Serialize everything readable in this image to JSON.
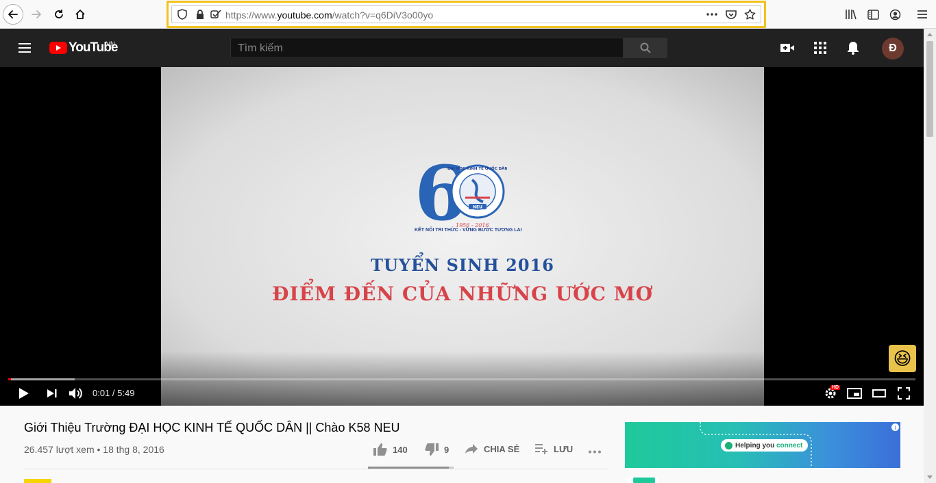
{
  "browser": {
    "url_prefix": "https://www.",
    "url_host": "youtube.com",
    "url_path": "/watch?v=q6DiV3o00yo",
    "accent_color": "#f3c21d"
  },
  "header": {
    "logo_text": "YouTube",
    "region": "VN",
    "search_placeholder": "Tìm kiếm",
    "avatar_initial": "Đ"
  },
  "player": {
    "logo_number": "6",
    "logo_ring_text": "ĐẠI HỌC KINH TẾ QUỐC DÂN",
    "logo_neu": "NEU",
    "logo_years": "1956 - 2016",
    "tagline": "KẾT NỐI TRI THỨC - VỮNG BƯỚC TƯƠNG LAI",
    "headline": "TUYỂN SINH 2016",
    "subheadline": "ĐIỂM ĐẾN CỦA NHỮNG ƯỚC MƠ",
    "time": "0:01 / 5:49",
    "played_fraction": 0.003,
    "buffered_fraction": 0.073,
    "quality_badge": "HD"
  },
  "video": {
    "title": "Giới Thiệu Trường ĐẠI HỌC KINH TẾ QUỐC DÂN || Chào K58 NEU",
    "meta": "26.457 lượt xem • 18 thg 8, 2016",
    "likes": "140",
    "dislikes": "9",
    "share_label": "CHIA SẺ",
    "save_label": "LƯU",
    "like_fraction": 0.94
  },
  "ad": {
    "pill_text_a": "Helping you ",
    "pill_text_b": "connect"
  }
}
